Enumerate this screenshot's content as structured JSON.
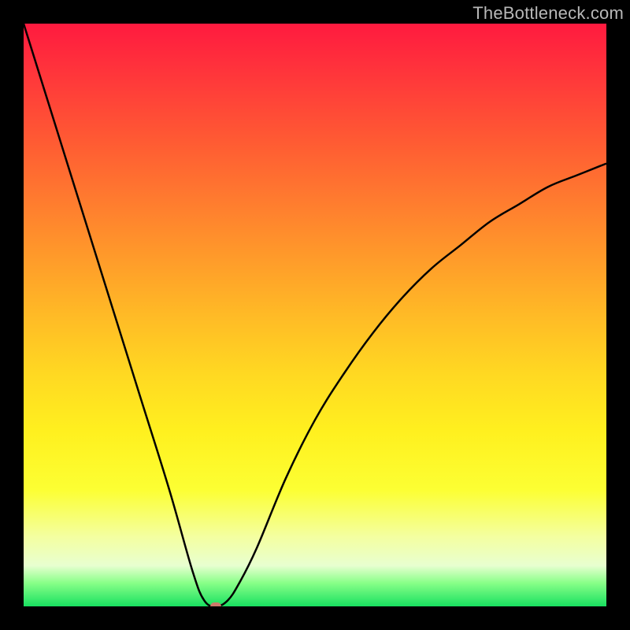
{
  "watermark": "TheBottleneck.com",
  "chart_data": {
    "type": "line",
    "title": "",
    "xlabel": "",
    "ylabel": "",
    "xlim": [
      0,
      100
    ],
    "ylim": [
      0,
      100
    ],
    "annotations": [],
    "background_gradient": [
      "#ff1a3f",
      "#ff9a2a",
      "#fff01f",
      "#18e060"
    ],
    "series": [
      {
        "name": "bottleneck-curve",
        "x": [
          0,
          5,
          10,
          15,
          20,
          25,
          29,
          31,
          33,
          35,
          37,
          40,
          45,
          50,
          55,
          60,
          65,
          70,
          75,
          80,
          85,
          90,
          95,
          100
        ],
        "y": [
          100,
          84,
          68,
          52,
          36,
          20,
          6,
          1,
          0,
          1,
          4,
          10,
          22,
          32,
          40,
          47,
          53,
          58,
          62,
          66,
          69,
          72,
          74,
          76
        ]
      }
    ],
    "marker": {
      "x": 33,
      "y": 0,
      "color": "#cc7a6a"
    }
  }
}
